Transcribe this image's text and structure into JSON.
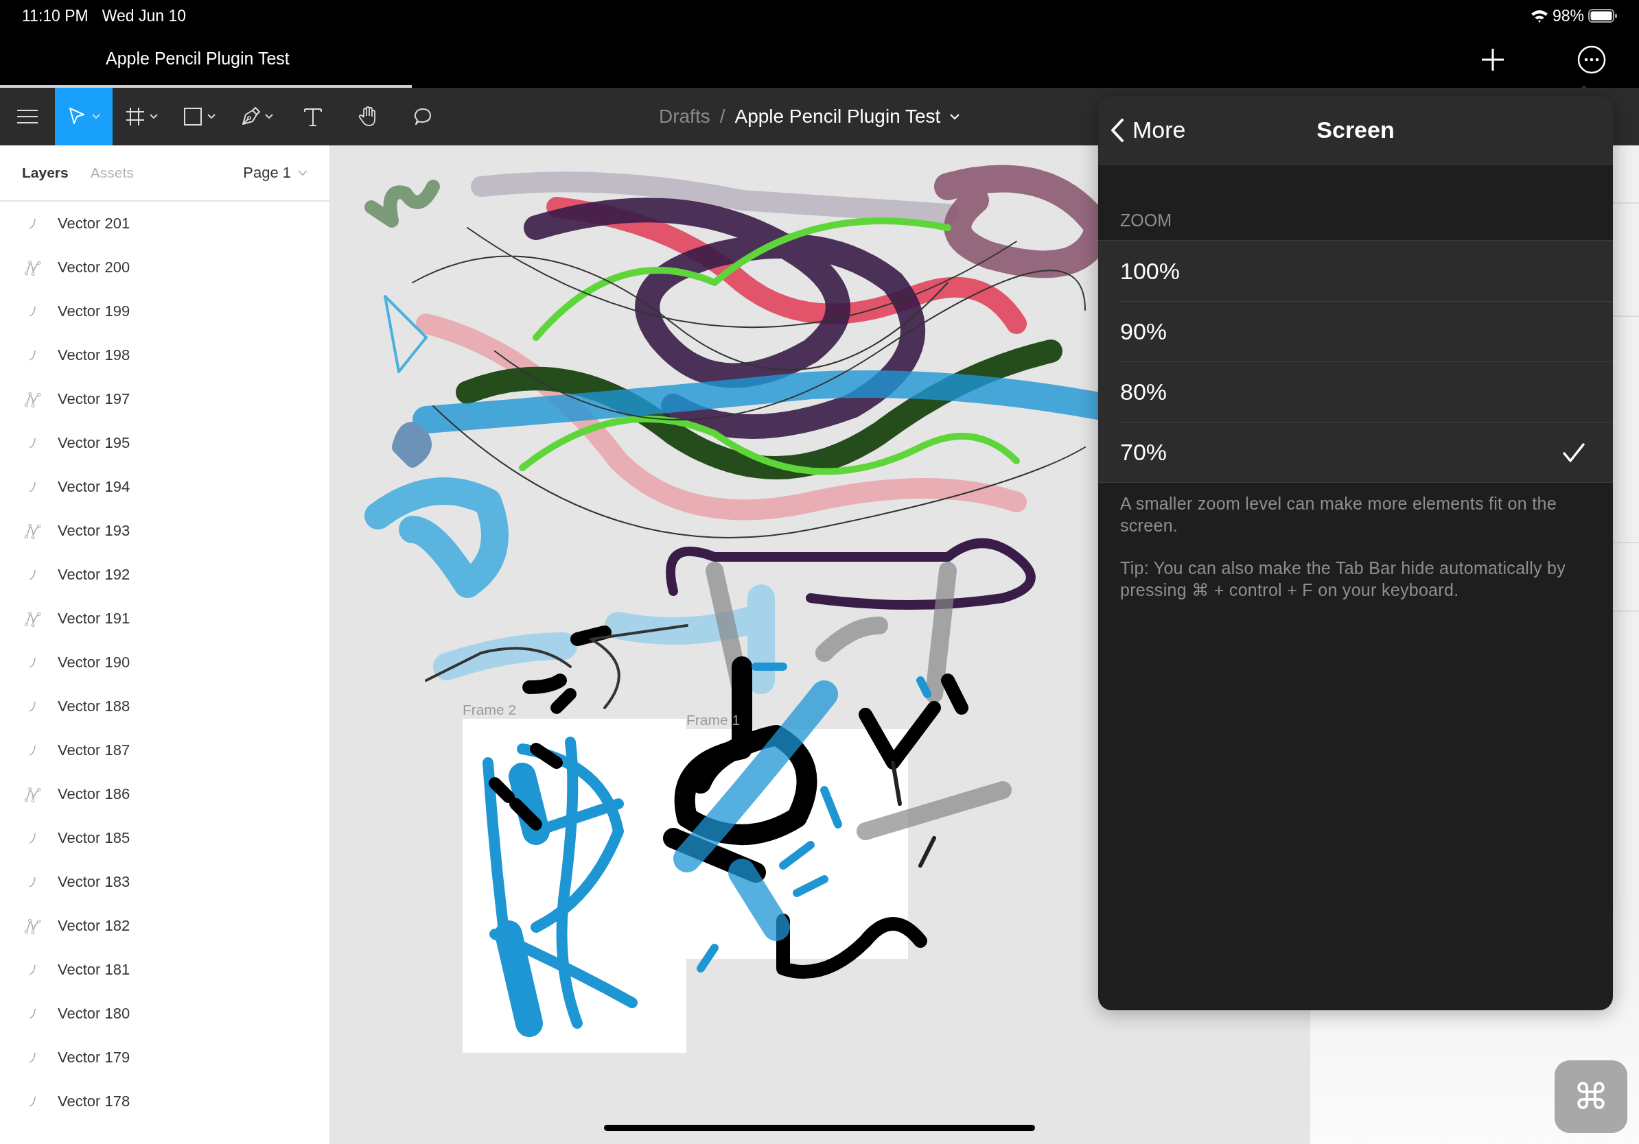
{
  "status_bar": {
    "time": "11:10 PM",
    "date": "Wed Jun 10",
    "battery": "98%"
  },
  "tab_bar": {
    "tab_title": "Apple Pencil Plugin Test"
  },
  "toolbar": {
    "tools": [
      {
        "kind": "move",
        "selected": true,
        "has_menu": true
      },
      {
        "kind": "frame",
        "selected": false,
        "has_menu": true
      },
      {
        "kind": "rectangle",
        "selected": false,
        "has_menu": true
      },
      {
        "kind": "pen",
        "selected": false,
        "has_menu": true
      },
      {
        "kind": "text",
        "selected": false,
        "has_menu": false
      },
      {
        "kind": "hand",
        "selected": false,
        "has_menu": false
      },
      {
        "kind": "comment",
        "selected": false,
        "has_menu": false
      }
    ],
    "breadcrumb": {
      "folder": "Drafts",
      "separator": "/",
      "file": "Apple Pencil Plugin Test"
    }
  },
  "layers_panel": {
    "tabs": [
      {
        "label": "Layers",
        "selected": true
      },
      {
        "label": "Assets",
        "selected": false
      }
    ],
    "page": "Page 1",
    "layers": [
      {
        "name": "Vector 201",
        "kind": "stroke"
      },
      {
        "name": "Vector 200",
        "kind": "network"
      },
      {
        "name": "Vector 199",
        "kind": "stroke"
      },
      {
        "name": "Vector 198",
        "kind": "stroke"
      },
      {
        "name": "Vector 197",
        "kind": "network"
      },
      {
        "name": "Vector 195",
        "kind": "stroke"
      },
      {
        "name": "Vector 194",
        "kind": "stroke"
      },
      {
        "name": "Vector 193",
        "kind": "network"
      },
      {
        "name": "Vector 192",
        "kind": "stroke"
      },
      {
        "name": "Vector 191",
        "kind": "network"
      },
      {
        "name": "Vector 190",
        "kind": "stroke"
      },
      {
        "name": "Vector 188",
        "kind": "stroke"
      },
      {
        "name": "Vector 187",
        "kind": "stroke"
      },
      {
        "name": "Vector 186",
        "kind": "network"
      },
      {
        "name": "Vector 185",
        "kind": "stroke"
      },
      {
        "name": "Vector 183",
        "kind": "stroke"
      },
      {
        "name": "Vector 182",
        "kind": "network"
      },
      {
        "name": "Vector 181",
        "kind": "stroke"
      },
      {
        "name": "Vector 180",
        "kind": "stroke"
      },
      {
        "name": "Vector 179",
        "kind": "stroke"
      },
      {
        "name": "Vector 178",
        "kind": "stroke"
      }
    ]
  },
  "canvas": {
    "frames": [
      {
        "label": "Frame 2"
      },
      {
        "label": "Frame 1"
      }
    ]
  },
  "popover": {
    "back": "More",
    "title": "Screen",
    "section": "ZOOM",
    "options": [
      {
        "label": "100%",
        "selected": false
      },
      {
        "label": "90%",
        "selected": false
      },
      {
        "label": "80%",
        "selected": false
      },
      {
        "label": "70%",
        "selected": true
      }
    ],
    "notes": [
      "A smaller zoom level can make more elements fit on the screen.",
      "Tip: You can also make the Tab Bar hide automatically by pressing ⌘ + control + F on your keyboard."
    ]
  },
  "keyboard_button": {
    "symbol": "⌘"
  }
}
